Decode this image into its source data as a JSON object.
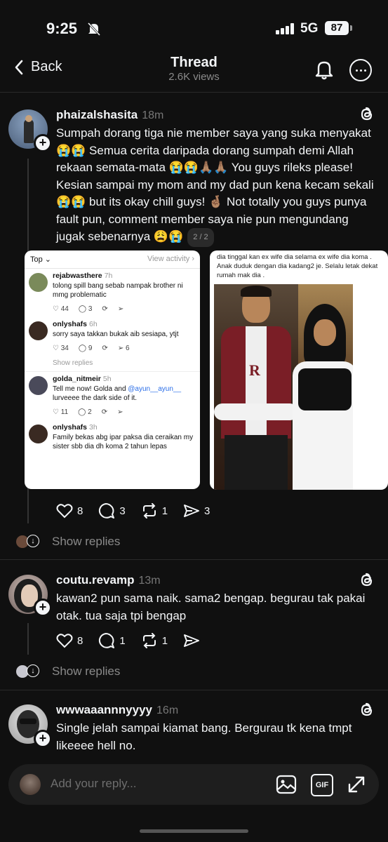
{
  "status": {
    "time": "9:25",
    "network": "5G",
    "battery": "87"
  },
  "nav": {
    "back_label": "Back",
    "title": "Thread",
    "subtitle": "2.6K views"
  },
  "posts": [
    {
      "username": "phaizalshasita",
      "time_ago": "18m",
      "text": "Sumpah dorang tiga nie member saya yang suka menyakat 😭😭 Semua cerita daripada dorang sumpah demi Allah rekaan semata-mata 😭😭🙏🏽🙏🏽 You guys rileks please! Kesian sampai my mom and my dad pun kena kecam sekali 😭😭 but its okay chill guys! 🤞🏽 Not totally you guys punya fault pun, comment member saya nie pun mengundang jugak sebenarnya 😩😭",
      "page_indicator": "2 / 2",
      "likes": "8",
      "replies": "3",
      "reposts": "1",
      "shares": "3",
      "show_replies": "Show replies"
    },
    {
      "username": "coutu.revamp",
      "time_ago": "13m",
      "text": "kawan2 pun sama naik. sama2 bengap. begurau tak pakai otak. tua saja tpi bengap",
      "likes": "8",
      "replies": "1",
      "reposts": "1",
      "show_replies": "Show replies"
    },
    {
      "username": "wwwaaannnyyyy",
      "time_ago": "16m",
      "text": "Single jelah sampai kiamat bang. Bergurau tk kena tmpt likeeee hell no."
    }
  ],
  "embed1": {
    "sort": "Top",
    "view_activity": "View activity",
    "comments": [
      {
        "user": "rejabwasthere",
        "age": "7h",
        "text": "tolong spill bang sebab nampak brother ni mmg problematic",
        "likes": "44",
        "replies": "3"
      },
      {
        "user": "onlyshafs",
        "age": "6h",
        "text": "sorry saya takkan bukak aib sesiapa, ytjt",
        "likes": "34",
        "replies": "9",
        "shares": "6"
      },
      {
        "user": "golda_nitmeir",
        "age": "5h",
        "text_a": "Tell me now! Golda and ",
        "mention": "@ayun__ayun__",
        "text_b": " lurveeee the dark side of it.",
        "likes": "11",
        "replies": "2"
      },
      {
        "user": "onlyshafs",
        "age": "3h",
        "text": "Family bekas abg ipar paksa dia ceraikan my sister sbb dia dh koma 2 tahun lepas"
      }
    ],
    "show_replies": "Show replies"
  },
  "embed2": {
    "caption": "dia tinggal kan ex wife dia selama ex wife dia koma . Anak duduk dengan dia kadang2 je. Selalu letak dekat rumah mak dia ."
  },
  "reply_bar": {
    "placeholder": "Add your reply...",
    "gif_label": "GIF"
  },
  "colors": {
    "background": "#101010",
    "text": "#f3f5f7",
    "muted": "#8a8a8a",
    "link": "#2a6ee8"
  }
}
